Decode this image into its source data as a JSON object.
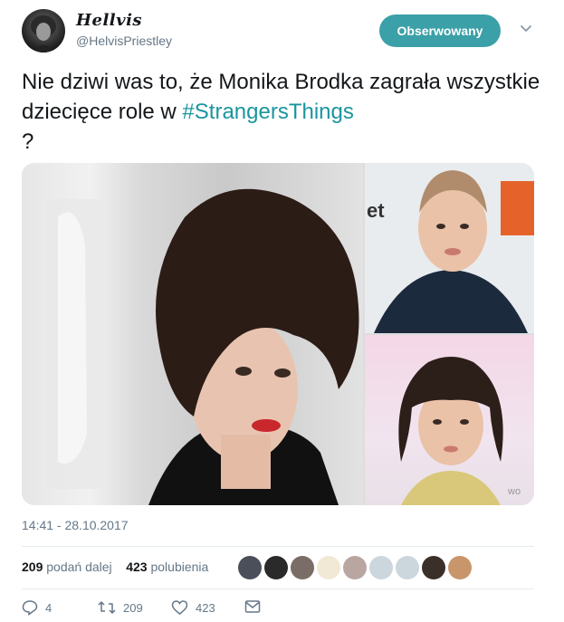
{
  "author": {
    "display_name": "Hellvis",
    "handle": "@HelvisPriestley"
  },
  "follow_button": {
    "label": "Obserwowany"
  },
  "tweet": {
    "text_before": "Nie dziwi was to, że Monika Brodka zagrała wszystkie dziecięce role w ",
    "hashtag": "#StrangersThings",
    "text_after": "?"
  },
  "media": {
    "photo_count": 3,
    "top_right_logo_text": "et",
    "bottom_right_watermark": "wo"
  },
  "timestamp": "14:41 - 28.10.2017",
  "stats": {
    "retweets_count": "209",
    "retweets_label": "podań dalej",
    "likes_count": "423",
    "likes_label": "polubienia"
  },
  "actions": {
    "reply_count": "4",
    "retweet_count": "209",
    "like_count": "423"
  },
  "colors": {
    "accent": "#3ba0a7",
    "hashtag": "#1b95a0",
    "muted": "#657786"
  },
  "icons": [
    "chevron-down-icon",
    "reply-icon",
    "retweet-icon",
    "heart-icon",
    "message-icon"
  ]
}
